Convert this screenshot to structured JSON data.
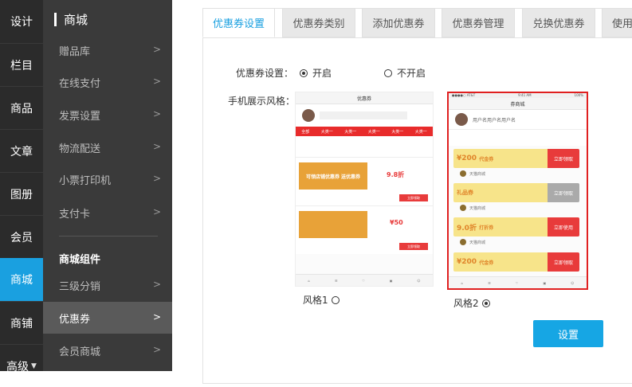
{
  "rail": {
    "items": [
      "设计",
      "栏目",
      "商品",
      "文章",
      "图册",
      "会员",
      "商城",
      "商铺"
    ],
    "more_label": "高级",
    "active_color": "#1aa0e0"
  },
  "submenu": {
    "title": "商城",
    "items": [
      "赠品库",
      "在线支付",
      "发票设置",
      "物流配送",
      "小票打印机",
      "支付卡"
    ],
    "group_title": "商城组件",
    "group_items": [
      "三级分销",
      "优惠券",
      "会员商城"
    ]
  },
  "tabs": [
    "优惠券设置",
    "优惠券类别",
    "添加优惠券",
    "优惠券管理",
    "兑换优惠券",
    "使用"
  ],
  "form": {
    "setting_label": "优惠券设置：",
    "option_on": "开启",
    "option_off": "不开启",
    "style_label": "手机展示风格："
  },
  "preview1": {
    "header": "优惠券",
    "tabs": [
      "全部",
      "大类一",
      "大类一",
      "大类一",
      "大类一",
      "大类一"
    ],
    "banner_text": "可领店铺优惠券 送优惠券",
    "discount": "9.8折",
    "amount": "¥50",
    "button": "立即领取"
  },
  "preview2": {
    "status_left": "●●●●○ AT&T",
    "status_time": "9:41 AM",
    "status_right": "100%",
    "header": "券商城",
    "user": "用户名用户名用户名",
    "coupons": [
      {
        "value": "¥200",
        "name": "代金券",
        "action": "立即领取"
      },
      {
        "value": "礼品券",
        "name": "",
        "action": "立即领取"
      },
      {
        "value": "9.0折",
        "name": "打折券",
        "action": "立即使用"
      },
      {
        "value": "¥200",
        "name": "代金券",
        "action": "立即领取"
      }
    ],
    "shop": "天猫商城"
  },
  "style_options": [
    "风格1",
    "风格2"
  ],
  "save_label": "设置"
}
